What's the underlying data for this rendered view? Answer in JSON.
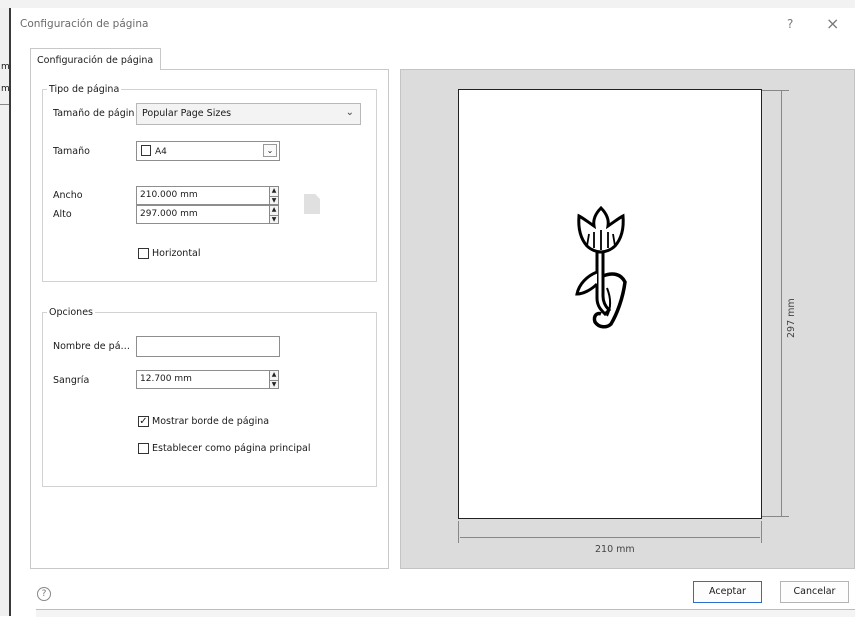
{
  "dialog": {
    "title": "Configuración de página",
    "help_glyph": "?",
    "close_glyph": "×"
  },
  "background": {
    "left_labels": [
      "m",
      "m"
    ]
  },
  "tab": {
    "label": "Configuración de página"
  },
  "page_type": {
    "legend": "Tipo de página",
    "page_size_label": "Tamaño de página",
    "page_size_value": "Popular Page Sizes",
    "size_label": "Tamaño",
    "size_value": "A4",
    "width_label": "Ancho",
    "width_value": "210.000 mm",
    "height_label": "Alto",
    "height_value": "297.000 mm",
    "landscape_label": "Horizontal",
    "landscape_checked": false
  },
  "options": {
    "legend": "Opciones",
    "page_name_label": "Nombre de pá…",
    "page_name_value": "",
    "indent_label": "Sangría",
    "indent_value": "12.700 mm",
    "show_border_label": "Mostrar borde de página",
    "show_border_checked": true,
    "set_main_label": "Establecer como página principal",
    "set_main_checked": false
  },
  "preview": {
    "height_dim": "297 mm",
    "width_dim": "210 mm"
  },
  "footer": {
    "help_glyph": "?",
    "ok_label": "Aceptar",
    "cancel_label": "Cancelar"
  },
  "icons": {
    "dropdown": "chevron-down-icon",
    "spin": "spinner-arrows-icon",
    "page": "page-portrait-icon",
    "flower": "tulip-image"
  }
}
